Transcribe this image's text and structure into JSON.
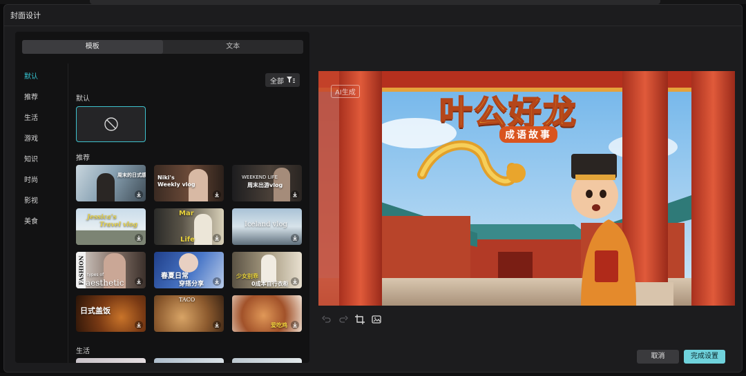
{
  "dialog": {
    "title": "封面设计"
  },
  "tabs": [
    {
      "label": "模板"
    },
    {
      "label": "文本"
    }
  ],
  "categories": [
    "默认",
    "推荐",
    "生活",
    "游戏",
    "知识",
    "时尚",
    "影视",
    "美食"
  ],
  "filter": {
    "label": "全部"
  },
  "sections": {
    "default": "默认",
    "recommend": "推荐",
    "life": "生活"
  },
  "thumb_texts": {
    "t1": "周末的日式感",
    "t2a": "Niki's",
    "t2b": "Weekly vlog",
    "t3a": "WEEKEND LIFE",
    "t3b": "周末出游vlog",
    "t4a": "Jessica's",
    "t4b": "Travel vlog",
    "t5a": "Mar",
    "t5b": "Life",
    "t6": "Iceland vlog",
    "t7a": "FASHION",
    "t7b": "types of",
    "t7c": "aesthetic",
    "t8a": "春夏日常",
    "t8b": "穿搭分享",
    "t9a": "少女别乖",
    "t9b": "0成本自行衣柜",
    "t10a": "日式盖饭",
    "t11": "TACO",
    "t12": "爱吃鸡"
  },
  "preview": {
    "ai_badge": "AI生成",
    "title": "叶公好龙",
    "subtitle": "成语故事"
  },
  "tools": [
    "undo-icon",
    "redo-icon",
    "crop-icon",
    "replace-image-icon"
  ],
  "actions": {
    "cancel": "取消",
    "done": "完成设置"
  },
  "colors": {
    "accent": "#36c6d3",
    "done_button": "#6fd2dc",
    "panel": "#121213",
    "dialog": "#1c1c1e"
  }
}
